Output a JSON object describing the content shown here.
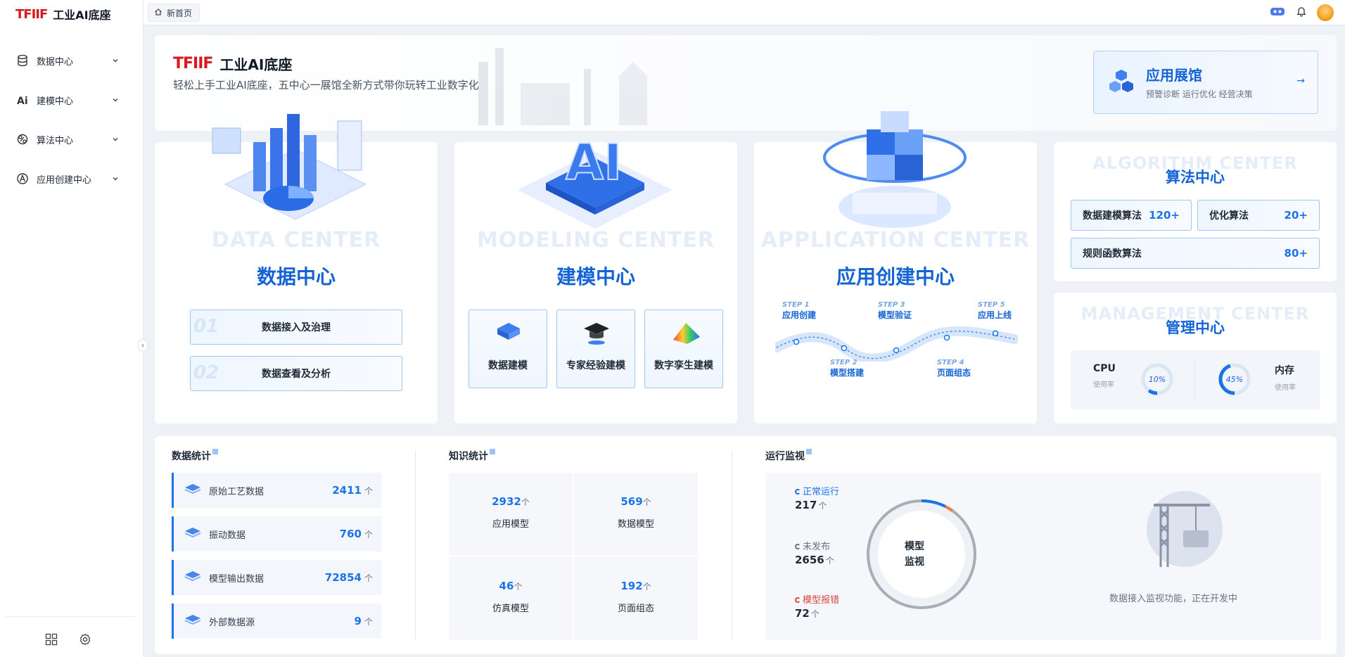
{
  "brand": {
    "logo": "TFIIF",
    "name": "工业AI底座"
  },
  "sidebar": {
    "items": [
      {
        "label": "数据中心",
        "icon": "database-icon"
      },
      {
        "label": "建模中心",
        "icon": "ai-model-icon"
      },
      {
        "label": "算法中心",
        "icon": "algorithm-icon"
      },
      {
        "label": "应用创建中心",
        "icon": "app-create-icon"
      }
    ]
  },
  "topbar": {
    "tab_label": "新首页"
  },
  "hero": {
    "logo": "TFIIF",
    "name": "工业AI底座",
    "subtitle": "轻松上手工业AI底座，五中心一展馆全新方式带你玩转工业数字化",
    "showcase": {
      "title": "应用展馆",
      "subtitle": "预警诊断 运行优化 经营决策",
      "arrow": "→"
    }
  },
  "data_center": {
    "watermark": "DATA CENTER",
    "title": "数据中心",
    "buttons": [
      {
        "num": "01",
        "label": "数据接入及治理"
      },
      {
        "num": "02",
        "label": "数据查看及分析"
      }
    ]
  },
  "modeling_center": {
    "watermark": "MODELING CENTER",
    "title": "建模中心",
    "boxes": [
      "数据建模",
      "专家经验建模",
      "数字孪生建模"
    ]
  },
  "application_center": {
    "watermark": "APPLICATION CENTER",
    "title": "应用创建中心",
    "steps": [
      {
        "num": "STEP 1",
        "label": "应用创建"
      },
      {
        "num": "STEP 2",
        "label": "模型搭建"
      },
      {
        "num": "STEP 3",
        "label": "模型验证"
      },
      {
        "num": "STEP 4",
        "label": "页面组态"
      },
      {
        "num": "STEP 5",
        "label": "应用上线"
      }
    ]
  },
  "algorithm_center": {
    "watermark": "ALGORITHM CENTER",
    "title": "算法中心",
    "items": [
      {
        "label": "数据建模算法",
        "value": "120+"
      },
      {
        "label": "优化算法",
        "value": "20+"
      },
      {
        "label": "规则函数算法",
        "value": "80+"
      }
    ]
  },
  "management_center": {
    "watermark": "MANAGEMENT CENTER",
    "title": "管理中心",
    "cpu": {
      "label": "CPU",
      "sub": "使用率",
      "value": "10%",
      "percent": 10
    },
    "memory": {
      "label": "内存",
      "sub": "使用率",
      "value": "45%",
      "percent": 45
    }
  },
  "data_stats": {
    "title": "数据统计",
    "rows": [
      {
        "label": "原始工艺数据",
        "value": "2411",
        "unit": "个"
      },
      {
        "label": "振动数据",
        "value": "760",
        "unit": "个"
      },
      {
        "label": "模型输出数据",
        "value": "72854",
        "unit": "个"
      },
      {
        "label": "外部数据源",
        "value": "9",
        "unit": "个"
      }
    ]
  },
  "knowledge_stats": {
    "title": "知识统计",
    "cells": [
      {
        "value": "2932",
        "unit": "个",
        "label": "应用模型"
      },
      {
        "value": "569",
        "unit": "个",
        "label": "数据模型"
      },
      {
        "value": "46",
        "unit": "个",
        "label": "仿真模型"
      },
      {
        "value": "192",
        "unit": "个",
        "label": "页面组态"
      }
    ]
  },
  "monitor": {
    "title": "运行监视",
    "items": [
      {
        "label": "正常运行",
        "value": "217",
        "unit": "个",
        "color": "#1a73e8"
      },
      {
        "label": "未发布",
        "value": "2656",
        "unit": "个",
        "color": "#6b7280"
      },
      {
        "label": "模型报错",
        "value": "72",
        "unit": "个",
        "color": "#d64545"
      }
    ],
    "donut_line1": "模型",
    "donut_line2": "监视",
    "dev_text": "数据接入监视功能，正在开发中"
  },
  "colors": {
    "primary": "#1a73e8",
    "title_blue": "#1464d6",
    "brand_red": "#d71921",
    "error": "#d64545"
  }
}
